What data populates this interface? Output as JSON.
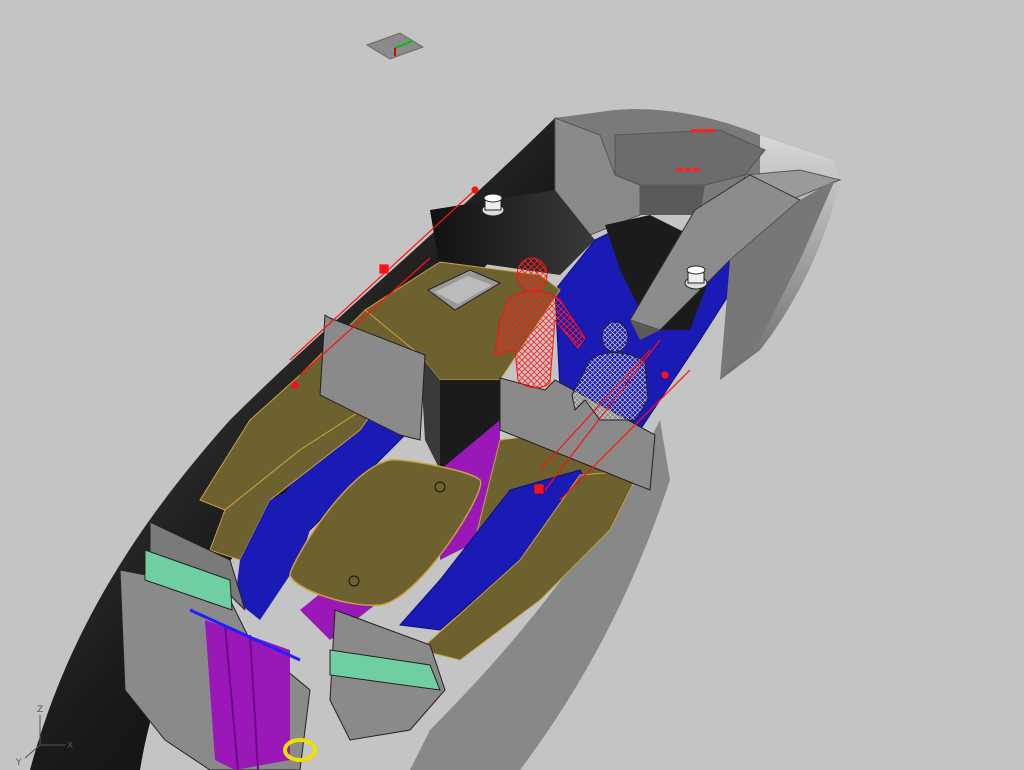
{
  "viewport": {
    "background": "#c4c4c4",
    "axis_labels": {
      "x": "X",
      "y": "Y",
      "z": "Z"
    }
  },
  "model": {
    "hull_color": "#8e8e8e",
    "deck_color": "#6e6130",
    "cushion_color": "#1a1ab4",
    "highlight_color": "#ff1010",
    "accent_purple": "#9a17b8",
    "accent_green": "#6fcfa0"
  },
  "icons": {
    "view_cube": "view-cube-icon",
    "axis_triad": "axis-triad-icon"
  }
}
